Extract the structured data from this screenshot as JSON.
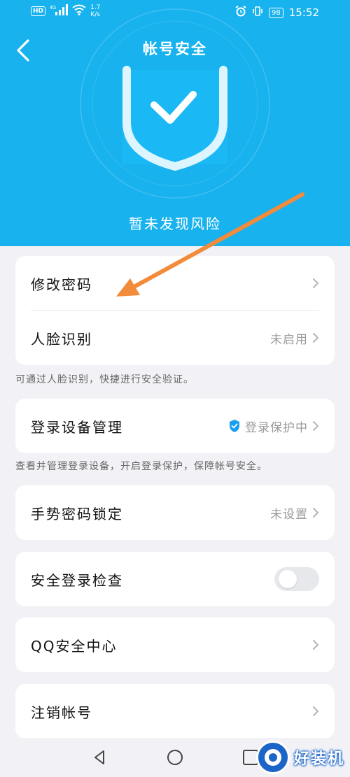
{
  "status_bar": {
    "hd": "HD",
    "network": "4G",
    "speed_value": "1.7",
    "speed_unit": "K/s",
    "battery": "98",
    "time": "15:52"
  },
  "header": {
    "title": "帐号安全",
    "status": "暂未发现风险"
  },
  "items": {
    "change_password": {
      "label": "修改密码"
    },
    "face_recognition": {
      "label": "人脸识别",
      "value": "未启用"
    },
    "face_note": "可通过人脸识别，快捷进行安全验证。",
    "device_management": {
      "label": "登录设备管理",
      "value": "登录保护中"
    },
    "device_note": "查看并管理登录设备，开启登录保护，保障帐号安全。",
    "gesture_lock": {
      "label": "手势密码锁定",
      "value": "未设置"
    },
    "safe_login_check": {
      "label": "安全登录检查",
      "toggle_on": false
    },
    "qq_security_center": {
      "label": "QQ安全中心"
    },
    "deactivate": {
      "label": "注销帐号"
    }
  },
  "watermark": {
    "text": "好装机"
  },
  "colors": {
    "header_bg": "#18b2ee",
    "page_bg": "#f2f2f6",
    "arrow": "#f28b3a",
    "shield_badge": "#1a9ff0"
  },
  "icons": {
    "back": "back-arrow-icon",
    "shield": "shield-check-icon",
    "chevron": "chevron-right-icon",
    "nav_back": "nav-back-icon",
    "nav_home": "nav-home-icon",
    "nav_recent": "nav-recent-icon"
  }
}
